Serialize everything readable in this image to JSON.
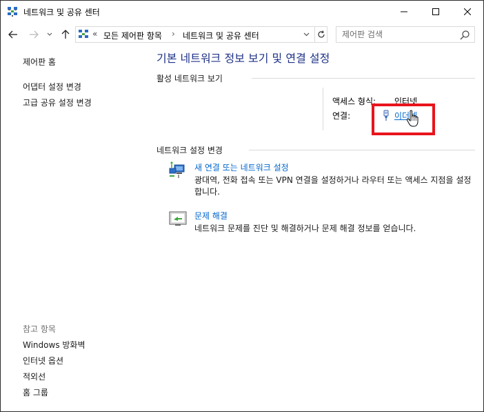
{
  "window": {
    "title": "네트워크 및 공유 센터"
  },
  "address": {
    "overflow": "«",
    "crumbs": [
      "모든 제어판 항목",
      "네트워크 및 공유 센터"
    ],
    "separator": "›"
  },
  "search": {
    "placeholder": "제어판 검색"
  },
  "leftnav": {
    "home": "제어판 홈",
    "adapter": "어댑터 설정 변경",
    "advanced": "고급 공유 설정 변경",
    "see_also": "참고 항목",
    "links": [
      "Windows 방화벽",
      "인터넷 옵션",
      "적외선",
      "홈 그룹"
    ]
  },
  "main": {
    "title": "기본 네트워크 정보 보기 및 연결 설정",
    "active_section": "활성 네트워크 보기",
    "access_label": "액세스 형식:",
    "access_value": "인터넷",
    "connection_label": "연결:",
    "connection_value": "이더넷",
    "settings_section": "네트워크 설정 변경",
    "tasks": [
      {
        "title": "새 연결 또는 네트워크 설정",
        "desc": "광대역, 전화 접속 또는 VPN 연결을 설정하거나 라우터 또는 액세스 지점을 설정합니다."
      },
      {
        "title": "문제 해결",
        "desc": "네트워크 문제를 진단 및 해결하거나 문제 해결 정보를 얻습니다."
      }
    ]
  },
  "colors": {
    "title_blue": "#1e3287",
    "link_blue": "#0066cc",
    "highlight_red": "#e8141c"
  },
  "icons": {
    "network": "network-center-icon",
    "ethernet": "ethernet-plug-icon",
    "new_connection": "new-connection-icon",
    "troubleshoot": "troubleshoot-icon",
    "cursor": "hand-cursor-icon"
  }
}
